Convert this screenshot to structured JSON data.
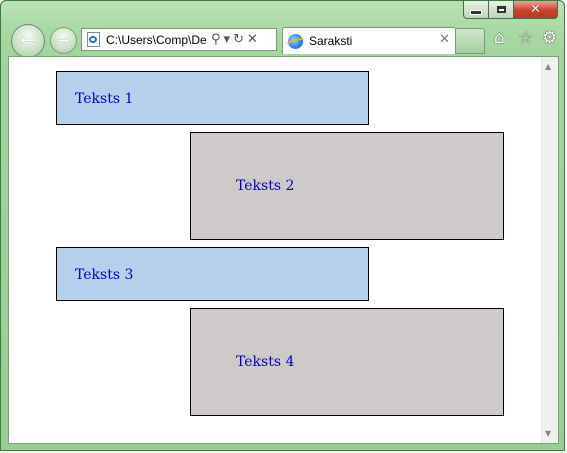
{
  "window": {
    "caption_buttons": {
      "minimize_icon": "minimize-icon",
      "maximize_icon": "maximize-icon",
      "close_glyph": "✕"
    }
  },
  "toolbar": {
    "back_glyph": "←",
    "forward_glyph": "→",
    "address_value": "C:\\Users\\Comp\\De",
    "search_glyph": "⚲",
    "dropdown_glyph": "▾",
    "refresh_glyph": "↻",
    "stop_glyph": "✕"
  },
  "tab": {
    "title": "Saraksti",
    "close_glyph": "✕"
  },
  "right_icons": {
    "home_glyph": "⌂",
    "favorites_glyph": "☆",
    "tools_glyph": "⚙"
  },
  "content": {
    "boxes": [
      {
        "label": "Teksts 1",
        "color": "#b6d1ee"
      },
      {
        "label": "Teksts 2",
        "color": "#cecaca"
      },
      {
        "label": "Teksts 3",
        "color": "#b6d1ee"
      },
      {
        "label": "Teksts 4",
        "color": "#cecaca"
      }
    ],
    "link_color": "#0000cc"
  },
  "scrollbar": {
    "up_glyph": "▲",
    "down_glyph": "▼"
  }
}
